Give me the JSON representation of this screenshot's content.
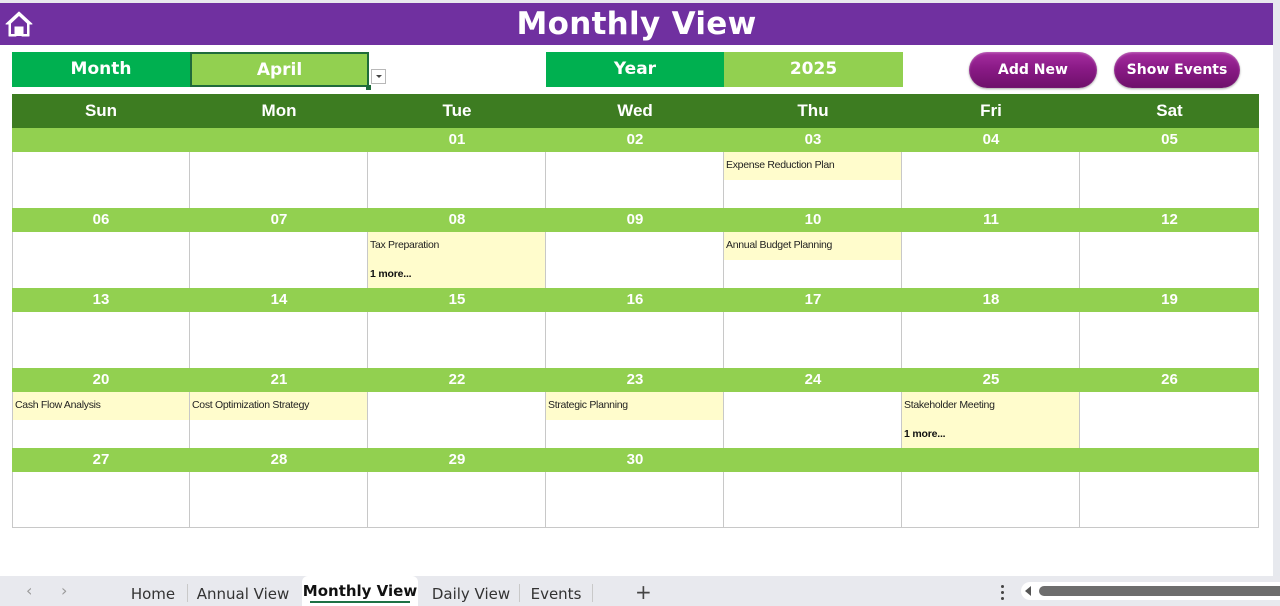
{
  "header": {
    "title": "Monthly View",
    "home_icon": "home-icon"
  },
  "controls": {
    "month_label": "Month",
    "month_value": "April",
    "year_label": "Year",
    "year_value": "2025",
    "add_new_label": "Add New",
    "show_events_label": "Show Events"
  },
  "colors": {
    "header_purple": "#7030a0",
    "label_green": "#00b050",
    "value_green": "#92d050",
    "dow_green": "#3d7c21",
    "event_yellow": "#fffccc",
    "button_magenta": "#8a1a86"
  },
  "calendar": {
    "days_of_week": [
      "Sun",
      "Mon",
      "Tue",
      "Wed",
      "Thu",
      "Fri",
      "Sat"
    ],
    "weeks": [
      {
        "days": [
          {
            "num": "",
            "event": "",
            "more": ""
          },
          {
            "num": "",
            "event": "",
            "more": ""
          },
          {
            "num": "01",
            "event": "",
            "more": ""
          },
          {
            "num": "02",
            "event": "",
            "more": ""
          },
          {
            "num": "03",
            "event": "Expense Reduction Plan",
            "more": ""
          },
          {
            "num": "04",
            "event": "",
            "more": ""
          },
          {
            "num": "05",
            "event": "",
            "more": ""
          }
        ]
      },
      {
        "days": [
          {
            "num": "06",
            "event": "",
            "more": ""
          },
          {
            "num": "07",
            "event": "",
            "more": ""
          },
          {
            "num": "08",
            "event": "Tax Preparation",
            "more": "1 more..."
          },
          {
            "num": "09",
            "event": "",
            "more": ""
          },
          {
            "num": "10",
            "event": "Annual Budget Planning",
            "more": ""
          },
          {
            "num": "11",
            "event": "",
            "more": ""
          },
          {
            "num": "12",
            "event": "",
            "more": ""
          }
        ]
      },
      {
        "days": [
          {
            "num": "13",
            "event": "",
            "more": ""
          },
          {
            "num": "14",
            "event": "",
            "more": ""
          },
          {
            "num": "15",
            "event": "",
            "more": ""
          },
          {
            "num": "16",
            "event": "",
            "more": ""
          },
          {
            "num": "17",
            "event": "",
            "more": ""
          },
          {
            "num": "18",
            "event": "",
            "more": ""
          },
          {
            "num": "19",
            "event": "",
            "more": ""
          }
        ]
      },
      {
        "days": [
          {
            "num": "20",
            "event": "Cash Flow Analysis",
            "more": ""
          },
          {
            "num": "21",
            "event": "Cost Optimization Strategy",
            "more": ""
          },
          {
            "num": "22",
            "event": "",
            "more": ""
          },
          {
            "num": "23",
            "event": "Strategic Planning",
            "more": ""
          },
          {
            "num": "24",
            "event": "",
            "more": ""
          },
          {
            "num": "25",
            "event": "Stakeholder Meeting",
            "more": "1 more..."
          },
          {
            "num": "26",
            "event": "",
            "more": ""
          }
        ]
      },
      {
        "days": [
          {
            "num": "27",
            "event": "",
            "more": ""
          },
          {
            "num": "28",
            "event": "",
            "more": ""
          },
          {
            "num": "29",
            "event": "",
            "more": ""
          },
          {
            "num": "30",
            "event": "",
            "more": ""
          },
          {
            "num": "",
            "event": "",
            "more": ""
          },
          {
            "num": "",
            "event": "",
            "more": ""
          },
          {
            "num": "",
            "event": "",
            "more": ""
          }
        ]
      }
    ]
  },
  "sheet_tabs": {
    "prev_icon": "chevron-left-icon",
    "next_icon": "chevron-right-icon",
    "tabs": [
      {
        "label": "Home",
        "active": false
      },
      {
        "label": "Annual View",
        "active": false
      },
      {
        "label": "Monthly View",
        "active": true
      },
      {
        "label": "Daily View",
        "active": false
      },
      {
        "label": "Events",
        "active": false
      }
    ],
    "add_sheet_label": "+"
  }
}
